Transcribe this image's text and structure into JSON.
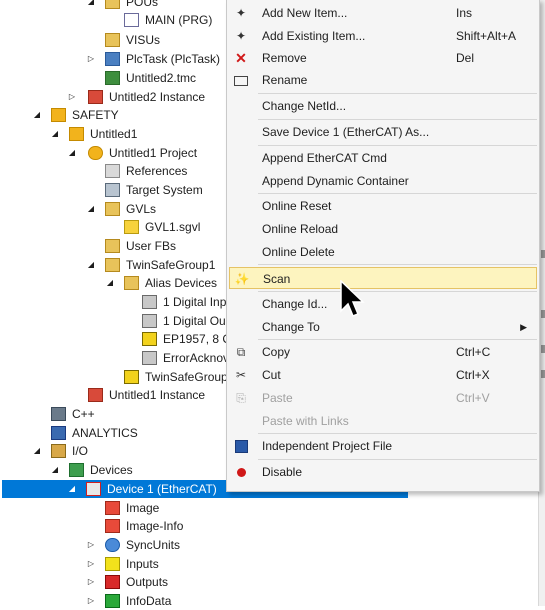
{
  "tree": {
    "items": [
      {
        "label": "POUs",
        "icon": "folder-icon"
      },
      {
        "label": "MAIN (PRG)",
        "icon": "program-icon"
      },
      {
        "label": "VISUs",
        "icon": "folder-icon"
      },
      {
        "label": "PlcTask (PlcTask)",
        "icon": "task-icon"
      },
      {
        "label": "Untitled2.tmc",
        "icon": "tmc-icon"
      },
      {
        "label": "Untitled2 Instance",
        "icon": "instance-icon"
      },
      {
        "label": "SAFETY",
        "icon": "safety-icon"
      },
      {
        "label": "Untitled1",
        "icon": "safety-project-icon"
      },
      {
        "label": "Untitled1 Project",
        "icon": "safety-project-icon"
      },
      {
        "label": "References",
        "icon": "references-icon"
      },
      {
        "label": "Target System",
        "icon": "target-system-icon"
      },
      {
        "label": "GVLs",
        "icon": "folder-icon"
      },
      {
        "label": "GVL1.sgvl",
        "icon": "gvl-icon"
      },
      {
        "label": "User FBs",
        "icon": "folder-icon"
      },
      {
        "label": "TwinSafeGroup1",
        "icon": "folder-icon"
      },
      {
        "label": "Alias Devices",
        "icon": "folder-icon"
      },
      {
        "label": "1 Digital Inp",
        "icon": "alias-device-icon"
      },
      {
        "label": "1 Digital Ou",
        "icon": "alias-device-icon"
      },
      {
        "label": "EP1957, 8 C",
        "icon": "ep-device-icon"
      },
      {
        "label": "ErrorAcknov",
        "icon": "alias-device-icon"
      },
      {
        "label": "TwinSafeGroup",
        "icon": "safe-group-icon"
      },
      {
        "label": "Untitled1 Instance",
        "icon": "instance-icon"
      },
      {
        "label": "C++",
        "icon": "cpp-icon"
      },
      {
        "label": "ANALYTICS",
        "icon": "analytics-icon"
      },
      {
        "label": "I/O",
        "icon": "io-icon"
      },
      {
        "label": "Devices",
        "icon": "devices-icon"
      },
      {
        "label": "Device 1 (EtherCAT)",
        "icon": "ethercat-device-icon"
      },
      {
        "label": "Image",
        "icon": "image-icon"
      },
      {
        "label": "Image-Info",
        "icon": "image-info-icon"
      },
      {
        "label": "SyncUnits",
        "icon": "sync-units-icon"
      },
      {
        "label": "Inputs",
        "icon": "inputs-icon"
      },
      {
        "label": "Outputs",
        "icon": "outputs-icon"
      },
      {
        "label": "InfoData",
        "icon": "infodata-icon"
      }
    ]
  },
  "context_menu": {
    "items": [
      {
        "label": "Add New Item...",
        "shortcut": "Ins",
        "icon": "add-new-item-icon"
      },
      {
        "label": "Add Existing Item...",
        "shortcut": "Shift+Alt+A",
        "icon": "add-existing-item-icon"
      },
      {
        "label": "Remove",
        "shortcut": "Del",
        "icon": "remove-icon"
      },
      {
        "label": "Rename",
        "shortcut": "",
        "icon": "rename-icon"
      },
      {
        "label": "Change NetId...",
        "shortcut": "",
        "icon": ""
      },
      {
        "label": "Save Device 1 (EtherCAT) As...",
        "shortcut": "",
        "icon": ""
      },
      {
        "label": "Append EtherCAT Cmd",
        "shortcut": "",
        "icon": ""
      },
      {
        "label": "Append Dynamic Container",
        "shortcut": "",
        "icon": ""
      },
      {
        "label": "Online Reset",
        "shortcut": "",
        "icon": ""
      },
      {
        "label": "Online Reload",
        "shortcut": "",
        "icon": ""
      },
      {
        "label": "Online Delete",
        "shortcut": "",
        "icon": ""
      },
      {
        "label": "Scan",
        "shortcut": "",
        "icon": "scan-wand-icon"
      },
      {
        "label": "Change Id...",
        "shortcut": "",
        "icon": ""
      },
      {
        "label": "Change To",
        "shortcut": "",
        "icon": ""
      },
      {
        "label": "Copy",
        "shortcut": "Ctrl+C",
        "icon": "copy-icon"
      },
      {
        "label": "Cut",
        "shortcut": "Ctrl+X",
        "icon": "cut-icon"
      },
      {
        "label": "Paste",
        "shortcut": "Ctrl+V",
        "icon": "paste-icon"
      },
      {
        "label": "Paste with Links",
        "shortcut": "",
        "icon": ""
      },
      {
        "label": "Independent Project File",
        "shortcut": "",
        "icon": "save-disk-icon"
      },
      {
        "label": "Disable",
        "shortcut": "",
        "icon": "disable-icon"
      }
    ]
  },
  "colors": {
    "selection": "#0078d7",
    "menu_hover": "#fdf4bf",
    "menu_background": "#f5f5f5"
  }
}
